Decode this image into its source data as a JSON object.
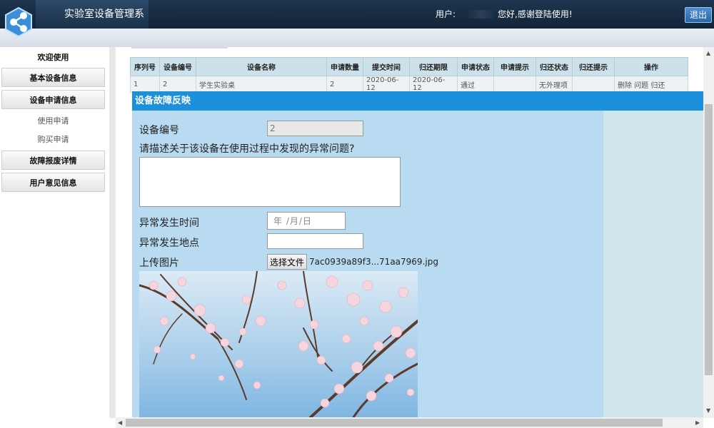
{
  "header": {
    "app_title": "实验室设备管理系统",
    "user_label": "用户:",
    "greeting": "您好,感谢登陆使用!",
    "logout_label": "退出"
  },
  "sidebar": {
    "items": [
      {
        "label": "欢迎使用"
      },
      {
        "label": "基本设备信息"
      },
      {
        "label": "设备申请信息"
      },
      {
        "label": "使用申请"
      },
      {
        "label": "购买申请"
      },
      {
        "label": "故障报废详情"
      },
      {
        "label": "用户意见信息"
      }
    ]
  },
  "table": {
    "headers": [
      "序列号",
      "设备编号",
      "设备名称",
      "申请数量",
      "提交时间",
      "归还期限",
      "申请状态",
      "申请提示",
      "归还状态",
      "归还提示",
      "操作"
    ],
    "row": [
      "1",
      "2",
      "学生实验桌",
      "2",
      "2020-06-12",
      "2020-06-12",
      "通过",
      "",
      "无外理项",
      "",
      "删除 问题 归还"
    ]
  },
  "modal": {
    "title": "设备故障反映",
    "device_no_label": "设备编号",
    "device_no_value": "2",
    "question_label": "请描述关于该设备在使用过程中发现的异常问题?",
    "time_label": "异常发生时间",
    "date_placeholder": "年 /月/日",
    "place_label": "异常发生地点",
    "upload_label": "上传图片",
    "choose_file_label": "选择文件",
    "file_name": "7ac0939a89f3...71aa7969.jpg"
  },
  "colors": {
    "modal_header": "#1d90dc",
    "modal_body": "#b9dbf2",
    "topbar": "#1e3550"
  }
}
